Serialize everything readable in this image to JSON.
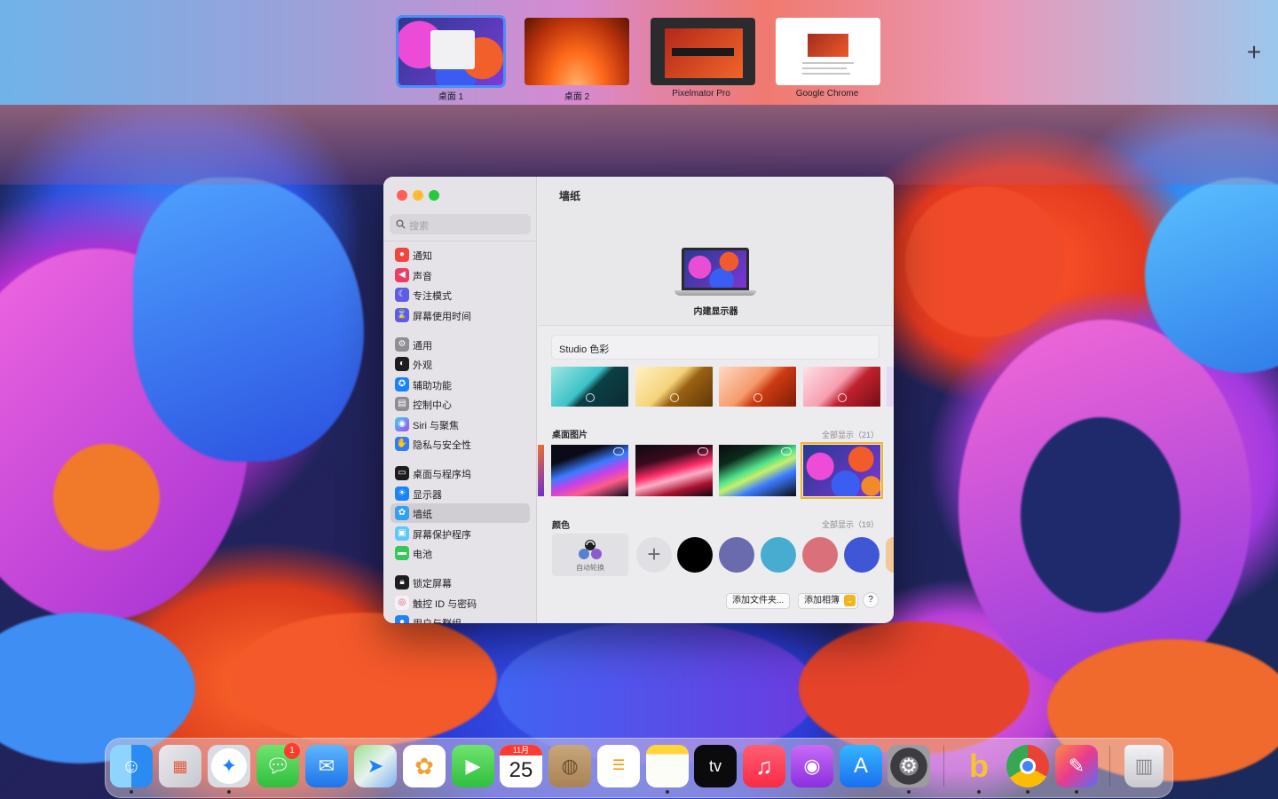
{
  "spaces": [
    {
      "label": "桌面 1",
      "active": true
    },
    {
      "label": "桌面 2",
      "active": false
    },
    {
      "label": "Pixelmator Pro",
      "active": false
    },
    {
      "label": "Google Chrome",
      "active": false
    }
  ],
  "add_space_glyph": "+",
  "settings": {
    "search_placeholder": "搜索",
    "sidebar_groups": [
      [
        {
          "label": "通知",
          "icon": "bell-icon",
          "color": "#f2453d"
        },
        {
          "label": "声音",
          "icon": "speaker-icon",
          "color": "#ee3c64"
        },
        {
          "label": "专注模式",
          "icon": "moon-icon",
          "color": "#5e5ce6"
        },
        {
          "label": "屏幕使用时间",
          "icon": "hourglass-icon",
          "color": "#5e5ce6"
        }
      ],
      [
        {
          "label": "通用",
          "icon": "gear-icon",
          "color": "#8e8e93"
        },
        {
          "label": "外观",
          "icon": "appearance-icon",
          "color": "#1d1d1f"
        },
        {
          "label": "辅助功能",
          "icon": "accessibility-icon",
          "color": "#1a82fb"
        },
        {
          "label": "控制中心",
          "icon": "control-center-icon",
          "color": "#8e8e93"
        },
        {
          "label": "Siri 与聚焦",
          "icon": "siri-icon",
          "color": "#7a5af5"
        },
        {
          "label": "隐私与安全性",
          "icon": "hand-icon",
          "color": "#2f7cf6"
        }
      ],
      [
        {
          "label": "桌面与程序坞",
          "icon": "dock-icon",
          "color": "#1d1d1f"
        },
        {
          "label": "显示器",
          "icon": "sun-icon",
          "color": "#1a82fb"
        },
        {
          "label": "墙纸",
          "icon": "wallpaper-icon",
          "color": "#32a0f0",
          "selected": true
        },
        {
          "label": "屏幕保护程序",
          "icon": "screensaver-icon",
          "color": "#5ac8fa"
        },
        {
          "label": "电池",
          "icon": "battery-icon",
          "color": "#34c759"
        }
      ],
      [
        {
          "label": "锁定屏幕",
          "icon": "lock-icon",
          "color": "#1d1d1f"
        },
        {
          "label": "触控 ID 与密码",
          "icon": "fingerprint-icon",
          "color": "#f2f2f4"
        },
        {
          "label": "用户与群组",
          "icon": "users-icon",
          "color": "#1a82fb"
        }
      ]
    ],
    "content": {
      "title": "墙纸",
      "display_name": "内建显示器",
      "category_select": "Studio 色彩",
      "desktop_pictures": {
        "title": "桌面图片",
        "show_all": "全部显示（21）"
      },
      "colors": {
        "title": "颜色",
        "show_all": "全部显示（19）",
        "auto_rotate_label": "自动轮换",
        "swatches": [
          "#000000",
          "#6a6aaf",
          "#48acd0",
          "#d9707a",
          "#3f56d6"
        ]
      },
      "buttons": {
        "add_folder": "添加文件夹...",
        "add_album": "添加相簿",
        "help": "?"
      }
    }
  },
  "dock": {
    "apps": [
      {
        "name": "Finder",
        "icon": "finder-icon",
        "running": true
      },
      {
        "name": "Launchpad",
        "icon": "launchpad-icon",
        "running": false
      },
      {
        "name": "Safari",
        "icon": "safari-icon",
        "running": true
      },
      {
        "name": "信息",
        "icon": "messages-icon",
        "running": false,
        "badge": "1"
      },
      {
        "name": "邮件",
        "icon": "mail-icon",
        "running": false
      },
      {
        "name": "地图",
        "icon": "maps-icon",
        "running": false
      },
      {
        "name": "照片",
        "icon": "photos-icon",
        "running": false
      },
      {
        "name": "FaceTime",
        "icon": "facetime-icon",
        "running": false
      },
      {
        "name": "日历",
        "icon": "calendar-icon",
        "running": false,
        "month": "11月",
        "day": "25"
      },
      {
        "name": "通讯录",
        "icon": "contacts-icon",
        "running": false
      },
      {
        "name": "提醒事项",
        "icon": "reminders-icon",
        "running": false
      },
      {
        "name": "备忘录",
        "icon": "notes-icon",
        "running": true
      },
      {
        "name": "TV",
        "icon": "appletv-icon",
        "running": false,
        "text": "tv"
      },
      {
        "name": "音乐",
        "icon": "music-icon",
        "running": false
      },
      {
        "name": "播客",
        "icon": "podcasts-icon",
        "running": false
      },
      {
        "name": "App Store",
        "icon": "appstore-icon",
        "running": false
      },
      {
        "name": "系统设置",
        "icon": "system-settings-icon",
        "running": true
      },
      {
        "name": "Bing",
        "icon": "bing-icon",
        "running": true
      },
      {
        "name": "Google Chrome",
        "icon": "chrome-icon",
        "running": true
      },
      {
        "name": "Pixelmator Pro",
        "icon": "pixelmator-icon",
        "running": true
      },
      {
        "name": "废纸篓",
        "icon": "trash-icon",
        "running": false
      }
    ]
  }
}
